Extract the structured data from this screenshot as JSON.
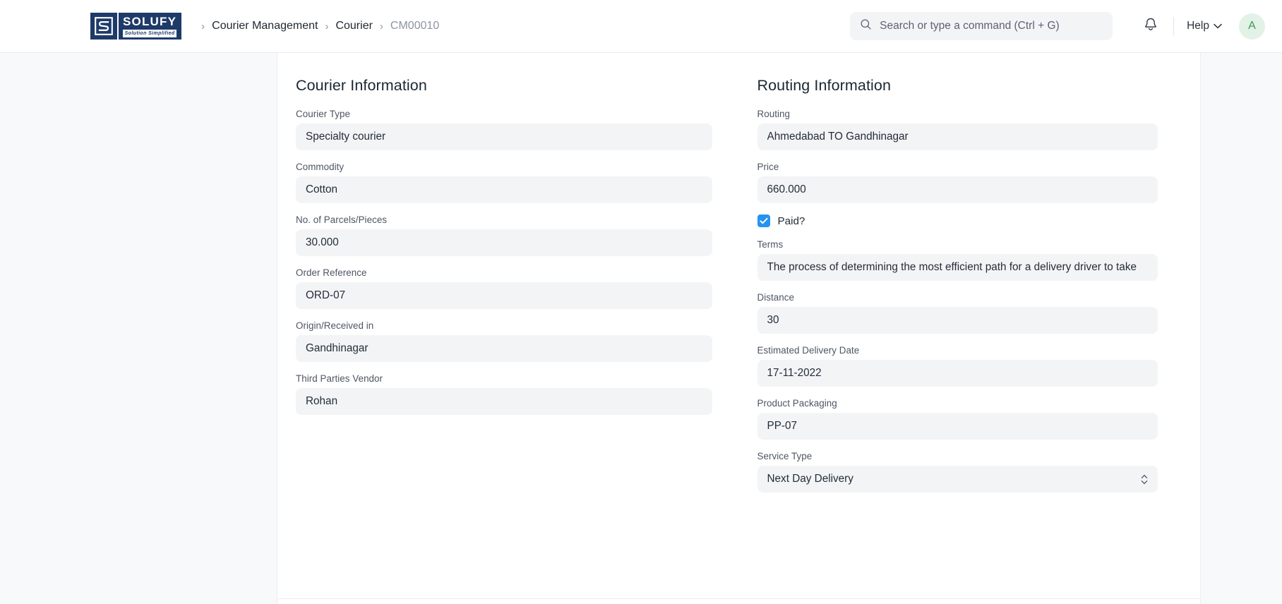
{
  "header": {
    "logo": {
      "word": "SOLUFY",
      "tagline": "Solution Simplified",
      "mark_letter": "S"
    },
    "breadcrumb": {
      "separator": "›",
      "items": [
        {
          "label": "Courier Management",
          "current": false
        },
        {
          "label": "Courier",
          "current": false
        },
        {
          "label": "CM00010",
          "current": true
        }
      ]
    },
    "search": {
      "placeholder": "Search or type a command (Ctrl + G)",
      "value": "",
      "icon": "search-icon"
    },
    "notifications_icon": "bell-icon",
    "help": {
      "label": "Help",
      "icon": "chevron-down-icon"
    },
    "avatar": {
      "initial": "A",
      "bg": "#e2f2e6",
      "fg": "#3c9a56"
    }
  },
  "main": {
    "left_section": {
      "title": "Courier Information",
      "fields": [
        {
          "label": "Courier Type",
          "value": "Specialty courier"
        },
        {
          "label": "Commodity",
          "value": "Cotton"
        },
        {
          "label": "No. of Parcels/Pieces",
          "value": "30.000"
        },
        {
          "label": "Order Reference",
          "value": "ORD-07"
        },
        {
          "label": "Origin/Received in",
          "value": "Gandhinagar"
        },
        {
          "label": "Third Parties Vendor",
          "value": "Rohan"
        }
      ]
    },
    "right_section": {
      "title": "Routing Information",
      "routing": {
        "label": "Routing",
        "value": "Ahmedabad TO Gandhinagar"
      },
      "price": {
        "label": "Price",
        "value": "660.000"
      },
      "paid": {
        "label": "Paid?",
        "checked": true,
        "color": "#2593f1"
      },
      "terms": {
        "label": "Terms",
        "value": "The process of determining the most efficient path for a delivery driver to take"
      },
      "distance": {
        "label": "Distance",
        "value": "30"
      },
      "estimated_delivery_date": {
        "label": "Estimated Delivery Date",
        "value": "17-11-2022"
      },
      "product_packaging": {
        "label": "Product Packaging",
        "value": "PP-07"
      },
      "service_type": {
        "label": "Service Type",
        "value": "Next Day Delivery",
        "icon": "updown-chevrons-icon"
      }
    }
  },
  "colors": {
    "page_bg": "#f8f9fa",
    "card_bg": "#ffffff",
    "input_bg": "#f3f4f6",
    "brand_navy": "#1e3a68",
    "accent_blue": "#2593f1",
    "text_primary": "#242d38",
    "text_muted": "#8d94a3"
  }
}
